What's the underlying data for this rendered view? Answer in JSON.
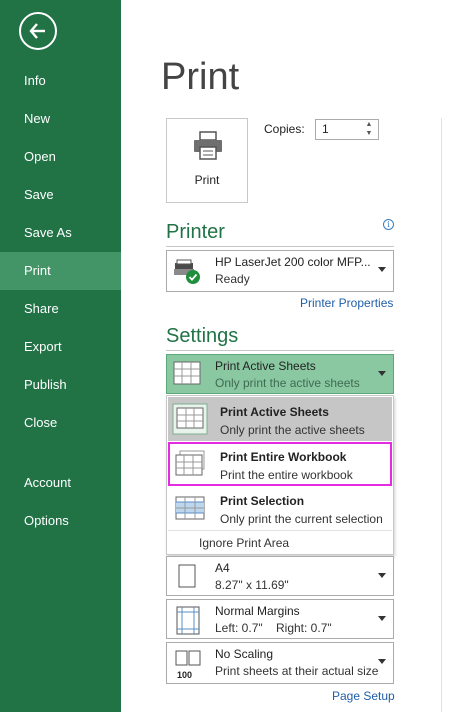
{
  "sidebar": {
    "items": [
      {
        "label": "Info"
      },
      {
        "label": "New"
      },
      {
        "label": "Open"
      },
      {
        "label": "Save"
      },
      {
        "label": "Save As"
      },
      {
        "label": "Print"
      },
      {
        "label": "Share"
      },
      {
        "label": "Export"
      },
      {
        "label": "Publish"
      },
      {
        "label": "Close"
      },
      {
        "label": "Account"
      },
      {
        "label": "Options"
      }
    ],
    "active": "Print"
  },
  "main": {
    "title": "Print",
    "print_button_label": "Print",
    "copies_label": "Copies:",
    "copies_value": "1",
    "printer_heading": "Printer",
    "printer": {
      "name": "HP LaserJet 200 color MFP...",
      "status": "Ready"
    },
    "printer_properties_link": "Printer Properties",
    "settings_heading": "Settings",
    "scope_dropdown": {
      "title": "Print Active Sheets",
      "subtitle": "Only print the active sheets"
    },
    "scope_menu": [
      {
        "title": "Print Active Sheets",
        "subtitle": "Only print the active sheets"
      },
      {
        "title": "Print Entire Workbook",
        "subtitle": "Print the entire workbook"
      },
      {
        "title": "Print Selection",
        "subtitle": "Only print the current selection"
      }
    ],
    "ignore_print_area": "Ignore Print Area",
    "paper": {
      "title": "A4",
      "subtitle": "8.27\" x 11.69\""
    },
    "margins": {
      "title": "Normal Margins",
      "left": "Left:  0.7\"",
      "right": "Right:  0.7\""
    },
    "scaling": {
      "title": "No Scaling",
      "subtitle": "Print sheets at their actual size",
      "icon_text": "100"
    },
    "page_setup_link": "Page Setup"
  },
  "colors": {
    "sidebar": "#217346",
    "sidebar_active": "#439467",
    "accent": "#217346",
    "highlight_frame": "#e62ae0",
    "link": "#1f5ea8"
  }
}
